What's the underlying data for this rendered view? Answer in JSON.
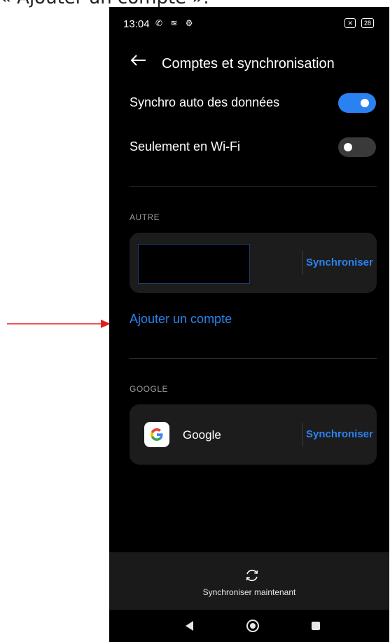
{
  "caption": "« Ajouter un compte ».",
  "status_bar": {
    "time": "13:04",
    "battery": "28"
  },
  "header": {
    "title": "Comptes et synchronisation"
  },
  "settings": [
    {
      "label": "Synchro auto des données",
      "enabled": true
    },
    {
      "label": "Seulement en Wi-Fi",
      "enabled": false
    }
  ],
  "sections": {
    "other": {
      "label": "AUTRE",
      "account": {
        "sync_label": "Synchroniser"
      },
      "add_account_label": "Ajouter un compte"
    },
    "google": {
      "label": "GOOGLE",
      "account": {
        "name": "Google",
        "sync_label": "Synchroniser"
      }
    }
  },
  "bottom": {
    "sync_now_label": "Synchroniser maintenant"
  },
  "colors": {
    "accent": "#2a82f0",
    "background": "#000000",
    "card": "#1c1c1c",
    "annotation_arrow": "#e0201a"
  },
  "icons": [
    "back-arrow-icon",
    "sync-icon",
    "google-logo-icon",
    "nav-back-icon",
    "nav-home-icon",
    "nav-recents-icon"
  ]
}
